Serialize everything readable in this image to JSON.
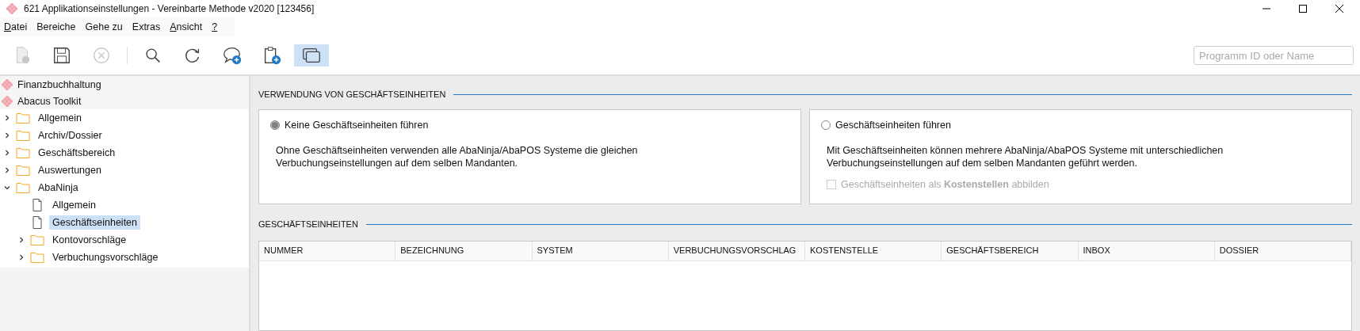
{
  "window": {
    "title": "621 Applikationseinstellungen - Vereinbarte Methode v2020 [123456]"
  },
  "menu": [
    {
      "label": "Datei",
      "mnemonic": true
    },
    {
      "label": "Bereiche",
      "mnemonic": false
    },
    {
      "label": "Gehe zu",
      "mnemonic": false
    },
    {
      "label": "Extras",
      "mnemonic": false
    },
    {
      "label": "Ansicht",
      "mnemonic": true
    },
    {
      "label": "?",
      "mnemonic": true
    }
  ],
  "toolbar": [
    {
      "kind": "new",
      "disabled": true,
      "selected": false
    },
    {
      "kind": "save",
      "disabled": false,
      "selected": false
    },
    {
      "kind": "cancel",
      "disabled": true,
      "selected": false
    },
    {
      "kind": "separator"
    },
    {
      "kind": "search",
      "disabled": false,
      "selected": false
    },
    {
      "kind": "refresh",
      "disabled": false,
      "selected": false
    },
    {
      "kind": "comment-add",
      "disabled": false,
      "selected": false
    },
    {
      "kind": "clipboard-add",
      "disabled": false,
      "selected": false
    },
    {
      "kind": "windows",
      "disabled": false,
      "selected": true
    }
  ],
  "search": {
    "placeholder": "Programm ID oder Name"
  },
  "sidebar": {
    "apps": [
      {
        "label": "Finanzbuchhaltung"
      },
      {
        "label": "Abacus Toolkit"
      }
    ],
    "tree": [
      {
        "label": "Allgemein",
        "kind": "folder",
        "expanded": false,
        "selected": false
      },
      {
        "label": "Archiv/Dossier",
        "kind": "folder",
        "expanded": false,
        "selected": false
      },
      {
        "label": "Geschäftsbereich",
        "kind": "folder",
        "expanded": false,
        "selected": false
      },
      {
        "label": "Auswertungen",
        "kind": "folder",
        "expanded": false,
        "selected": false
      },
      {
        "label": "AbaNinja",
        "kind": "folder",
        "expanded": true,
        "selected": false,
        "children": [
          {
            "label": "Allgemein",
            "kind": "document",
            "selected": false
          },
          {
            "label": "Geschäftseinheiten",
            "kind": "document",
            "selected": true
          },
          {
            "label": "Kontovorschläge",
            "kind": "folder",
            "expanded": false,
            "selected": false
          },
          {
            "label": "Verbuchungsvorschläge",
            "kind": "folder",
            "expanded": false,
            "selected": false
          }
        ]
      }
    ]
  },
  "usage_section": {
    "title": "VERWENDUNG VON GESCHÄFTSEINHEITEN",
    "options": [
      {
        "label": "Keine Geschäftseinheiten führen",
        "selected": true,
        "description": "Ohne Geschäftseinheiten verwenden alle AbaNinja/AbaPOS Systeme die gleichen Verbuchungseinstellungen auf dem selben Mandanten."
      },
      {
        "label": "Geschäftseinheiten führen",
        "selected": false,
        "description": "Mit Geschäftseinheiten können mehrere AbaNinja/AbaPOS Systeme mit unterschiedlichen Verbuchungseinstellungen auf dem selben Mandanten geführt werden.",
        "checkbox": {
          "label": "Geschäftseinheiten als **Kostenstellen** abbilden",
          "checked": false,
          "disabled": true
        }
      }
    ]
  },
  "units_section": {
    "title": "GESCHÄFTSEINHEITEN",
    "table": {
      "columns": [
        "NUMMER",
        "BEZEICHNUNG",
        "SYSTEM",
        "VERBUCHUNGSVORSCHLAG",
        "KOSTENSTELLE",
        "GESCHÄFTSBEREICH",
        "INBOX",
        "DOSSIER"
      ]
    }
  }
}
